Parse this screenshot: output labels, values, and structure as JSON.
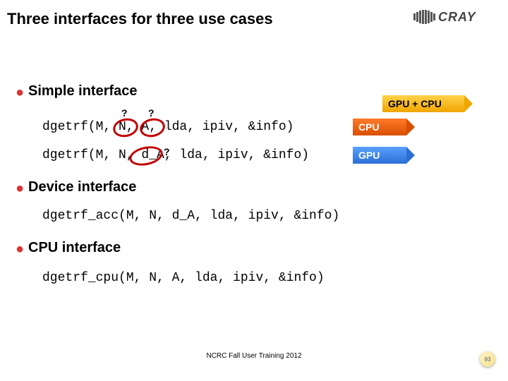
{
  "title": "Three interfaces for three use cases",
  "logo_text": "CRAY",
  "sections": {
    "simple": "Simple interface",
    "device": "Device interface",
    "cpu": "CPU interface"
  },
  "code": {
    "simple_cpu": "dgetrf(M, N, A, lda, ipiv, &info)",
    "simple_gpu": "dgetrf(M, N, d_A, lda, ipiv, &info)",
    "device": "dgetrf_acc(M, N, d_A, lda, ipiv, &info)",
    "cpu": "dgetrf_cpu(M, N, A, lda, ipiv, &info)"
  },
  "badges": {
    "gpucpu": "GPU + CPU",
    "cpu": "CPU",
    "gpu": "GPU"
  },
  "qmark": "?",
  "footer": "NCRC Fall User Training 2012",
  "page": "93"
}
